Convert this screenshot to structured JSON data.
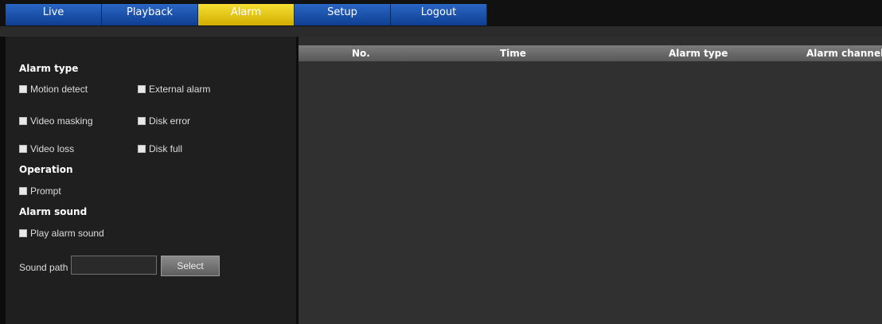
{
  "nav": {
    "tabs": [
      {
        "label": "Live"
      },
      {
        "label": "Playback"
      },
      {
        "label": "Alarm"
      },
      {
        "label": "Setup"
      },
      {
        "label": "Logout"
      }
    ],
    "active_tab": "Alarm"
  },
  "left_panel": {
    "alarm_type": {
      "title": "Alarm type",
      "options": [
        "Motion detect",
        "External alarm",
        "Video masking",
        "Disk error",
        "Video loss",
        "Disk full"
      ]
    },
    "operation": {
      "title": "Operation",
      "options": [
        "Prompt"
      ]
    },
    "alarm_sound": {
      "title": "Alarm sound",
      "options": [
        "Play alarm sound"
      ]
    },
    "sound_path": {
      "label": "Sound path",
      "value": "",
      "button_label": "Select"
    }
  },
  "table": {
    "columns": [
      "No.",
      "Time",
      "Alarm type",
      "Alarm channel"
    ],
    "rows": []
  },
  "colors": {
    "tab_blue": "#1f56b4",
    "tab_active_yellow": "#e8c81a",
    "panel_bg": "#1f1f1f",
    "table_bg": "#2e2e2e"
  }
}
